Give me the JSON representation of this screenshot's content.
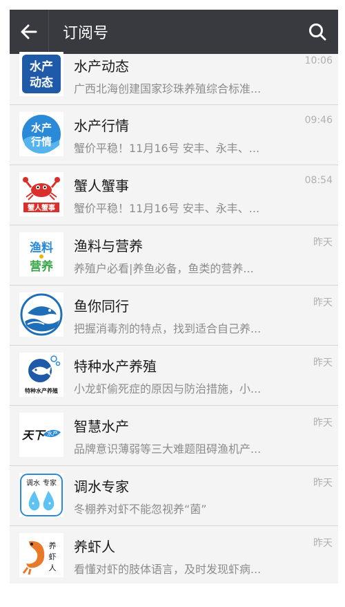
{
  "header": {
    "title": "订阅号"
  },
  "icons": {
    "back": "arrow-left-icon",
    "search": "search-icon"
  },
  "items": [
    {
      "name": "水产动态",
      "time": "10:06",
      "preview": "广西北海创建国家珍珠养殖综合标准...",
      "logo_text": [
        "水产",
        "动态"
      ]
    },
    {
      "name": "水产行情",
      "time": "09:46",
      "preview": "蟹价平稳！11月16号 安丰、永丰、...",
      "logo_text": [
        "水产",
        "行情"
      ]
    },
    {
      "name": "蟹人蟹事",
      "time": "08:54",
      "preview": "蟹价平稳！11月16号 安丰、永丰、...",
      "logo_text": [
        "蟹人蟹事"
      ]
    },
    {
      "name": "渔料与营养",
      "time": "昨天",
      "preview": "养殖户必看|养鱼必备，鱼类的营养...",
      "logo_text": [
        "渔料",
        "营养"
      ]
    },
    {
      "name": "鱼你同行",
      "time": "昨天",
      "preview": "把握消毒剂的特点，找到适合自己养...",
      "logo_text": []
    },
    {
      "name": "特种水产养殖",
      "time": "昨天",
      "preview": "小龙虾偷死症的原因与防治措施，小...",
      "logo_text": [
        "特种水产养殖"
      ]
    },
    {
      "name": "智慧水产",
      "time": "昨天",
      "preview": "品牌意识薄弱等三大难题阻碍渔机产...",
      "logo_text": [
        "天下",
        "水产"
      ]
    },
    {
      "name": "调水专家",
      "time": "昨天",
      "preview": "冬棚养对虾不能忽视养“菌”",
      "logo_text": [
        "调水",
        "专家"
      ]
    },
    {
      "name": "养虾人",
      "time": "昨天",
      "preview": "看懂对虾的肢体语言，及时发现虾病...",
      "logo_text": [
        "养",
        "虾",
        "人"
      ]
    }
  ],
  "colors": {
    "topbar": "#393a3f",
    "brand_blue": "#1e6fb8",
    "crab_red": "#d9302b",
    "shrimp_orange": "#e8782a"
  }
}
